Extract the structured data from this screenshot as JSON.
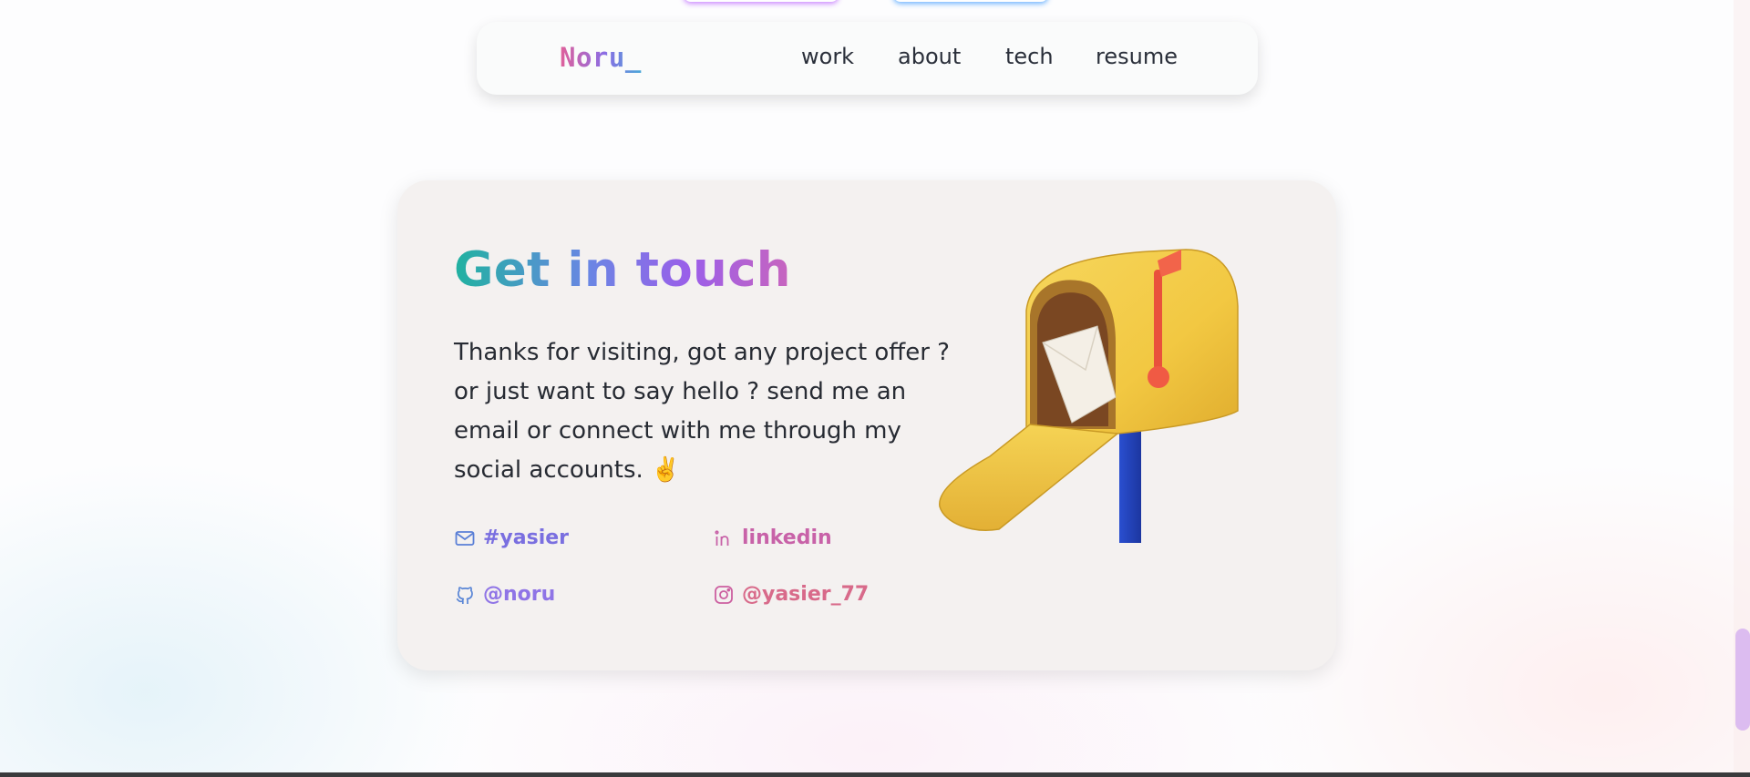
{
  "nav": {
    "logo": "Noru_",
    "links": [
      "work",
      "about",
      "tech",
      "resume"
    ]
  },
  "contact": {
    "heading": "Get in touch",
    "body": "Thanks for visiting, got any project offer ? or just want to say hello ? send me an email or connect with me through my social accounts. ✌️",
    "socials": {
      "email": "#yasier",
      "linkedin": "linkedin",
      "github": "@noru",
      "instagram": "@yasier_77"
    },
    "illustration": "mailbox-illustration"
  },
  "colors": {
    "heading_gradient": [
      "#20b2a0",
      "#6a86e4",
      "#9b5ee9",
      "#c865be"
    ],
    "logo_gradient": [
      "#e0609a",
      "#8b6de4",
      "#4aa8d8"
    ],
    "card_background": "#f4f1f0",
    "mailbox_yellow": "#f2c842",
    "flag_red": "#f2644a",
    "post_blue": "#2a4fd0"
  },
  "icons": [
    "mail-icon",
    "linkedin-icon",
    "github-icon",
    "instagram-icon"
  ]
}
